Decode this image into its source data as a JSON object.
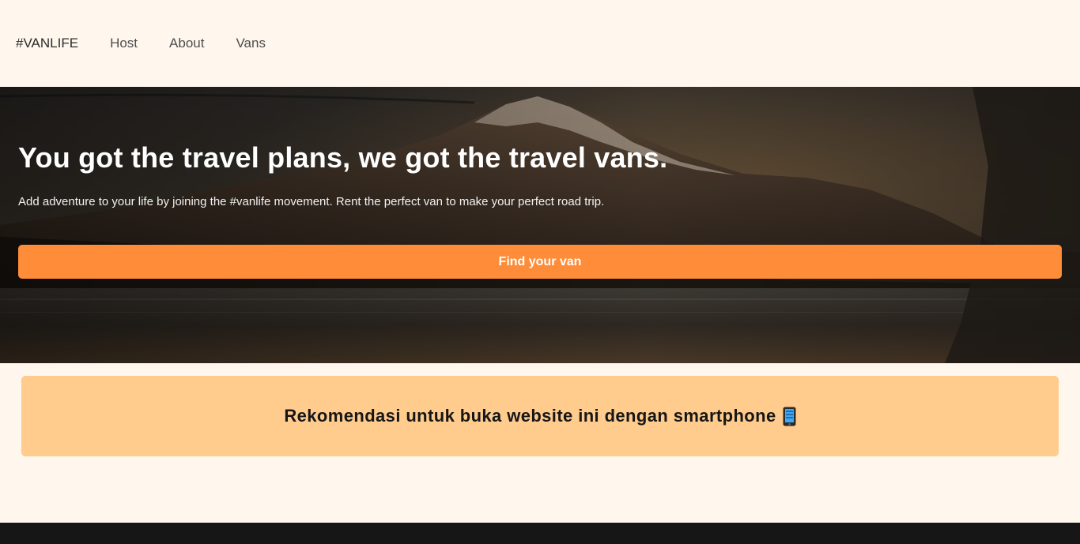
{
  "nav": {
    "logo": "#VANLIFE",
    "links": [
      "Host",
      "About",
      "Vans"
    ]
  },
  "hero": {
    "title": "You got the travel plans, we got the travel vans.",
    "subtitle": "Add adventure to your life by joining the #vanlife movement. Rent the perfect van to make your perfect road trip.",
    "cta_label": "Find your van",
    "background_icon": "mountain-lake-photo"
  },
  "notice": {
    "text": "Rekomendasi untuk buka website ini dengan smartphone",
    "icon": "smartphone-icon"
  },
  "colors": {
    "page_bg": "#FFF7ED",
    "accent": "#FF8C38",
    "notice_bg": "#FFCC8D",
    "footer_bg": "#161616"
  }
}
